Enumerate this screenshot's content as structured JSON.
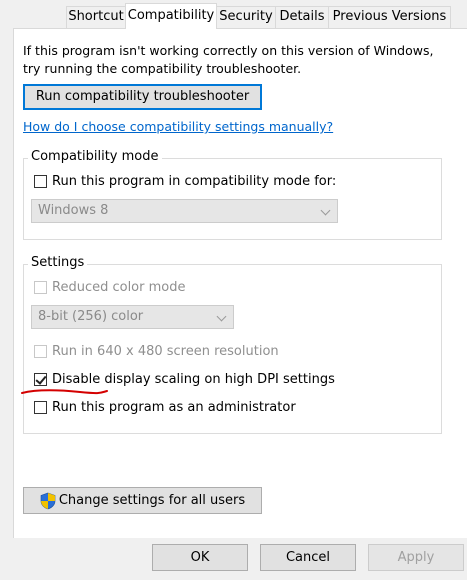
{
  "tabs": [
    {
      "label": "Shortcut",
      "active": false
    },
    {
      "label": "Compatibility",
      "active": true
    },
    {
      "label": "Security",
      "active": false
    },
    {
      "label": "Details",
      "active": false
    },
    {
      "label": "Previous Versions",
      "active": false
    }
  ],
  "intro_text": "If this program isn't working correctly on this version of Windows, try running the compatibility troubleshooter.",
  "run_troubleshooter_label": "Run compatibility troubleshooter",
  "manual_link": "How do I choose compatibility settings manually?",
  "compat_mode": {
    "group_label": "Compatibility mode",
    "checkbox_label": "Run this program in compatibility mode for:",
    "checked": false,
    "select_value": "Windows 8"
  },
  "settings": {
    "group_label": "Settings",
    "reduced_color": {
      "label": "Reduced color mode",
      "checked": false,
      "enabled": false
    },
    "color_select_value": "8-bit (256) color",
    "resolution": {
      "label": "Run in 640 x 480 screen resolution",
      "checked": false,
      "enabled": false
    },
    "dpi": {
      "label": "Disable display scaling on high DPI settings",
      "checked": true,
      "enabled": true
    },
    "admin": {
      "label": "Run this program as an administrator",
      "checked": false,
      "enabled": true
    }
  },
  "change_all_users_label": "Change settings for all users",
  "footer": {
    "ok": "OK",
    "cancel": "Cancel",
    "apply": "Apply"
  },
  "colors": {
    "link": "#0066cc",
    "focus_border": "#0078d7",
    "annotation": "#d40000",
    "shield_blue": "#2a6fd6",
    "shield_yellow": "#f2c200"
  },
  "icons": {
    "uac_shield": "uac-shield-icon"
  }
}
